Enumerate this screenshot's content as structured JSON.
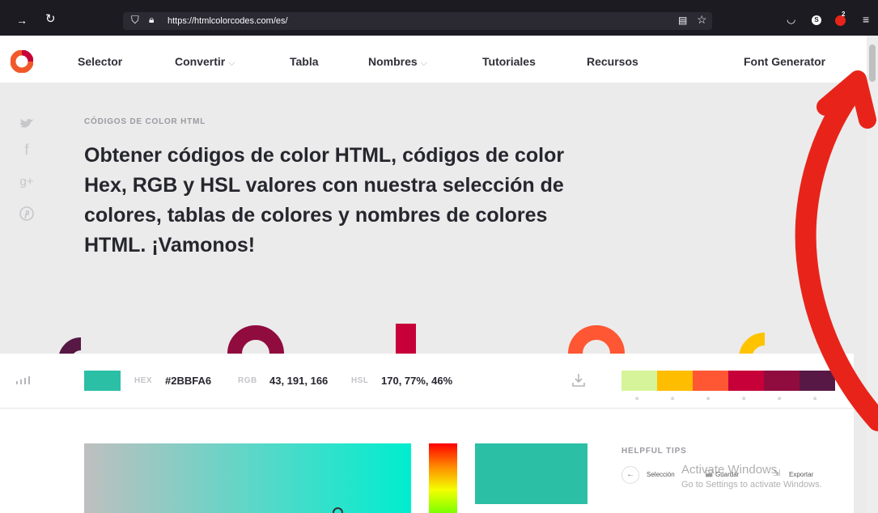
{
  "browser": {
    "url": "https://htmlcolorcodes.com/es/",
    "notification_count": "2"
  },
  "nav": {
    "items": [
      "Selector",
      "Convertir",
      "Tabla",
      "Nombres",
      "Tutoriales",
      "Recursos",
      "Font Generator"
    ]
  },
  "hero": {
    "label": "CÓDIGOS DE COLOR HTML",
    "title": "Obtener códigos de color HTML, códigos de color Hex, RGB y HSL valores con nuestra selección de colores, tablas de colores y nombres de colores HTML. ¡Vamonos!"
  },
  "color_bar": {
    "hex_label": "HEX",
    "hex_value": "#2BBFA6",
    "rgb_label": "RGB",
    "rgb_value": "43, 191, 166",
    "hsl_label": "HSL",
    "hsl_value": "170, 77%, 46%",
    "swatch_color": "#2BBFA6",
    "palette": [
      "#d6f59a",
      "#ffbd00",
      "#ff5733",
      "#c70039",
      "#900c3f",
      "#571845"
    ]
  },
  "decor": {
    "shape_colors": [
      "#571845",
      "#900c3f",
      "#c70039",
      "#ff5733",
      "#ffc300"
    ]
  },
  "tips": {
    "title": "HELPFUL TIPS",
    "items": [
      "Selección",
      "Guardar",
      "Exportar"
    ]
  },
  "watermark": {
    "line1": "Activate Windows",
    "line2": "Go to Settings to activate Windows."
  },
  "icons": {
    "browser": [
      "forward-icon",
      "reload-icon",
      "shield-icon",
      "lock-icon",
      "reader-icon",
      "bookmark-star-icon",
      "pocket-icon",
      "profile-icon",
      "extension-icon",
      "menu-icon"
    ],
    "social": [
      "twitter-icon",
      "facebook-icon",
      "google-plus-icon",
      "pinterest-icon"
    ],
    "toolbar": [
      "chart-icon",
      "download-icon"
    ]
  },
  "accent_color": "#e8241a"
}
